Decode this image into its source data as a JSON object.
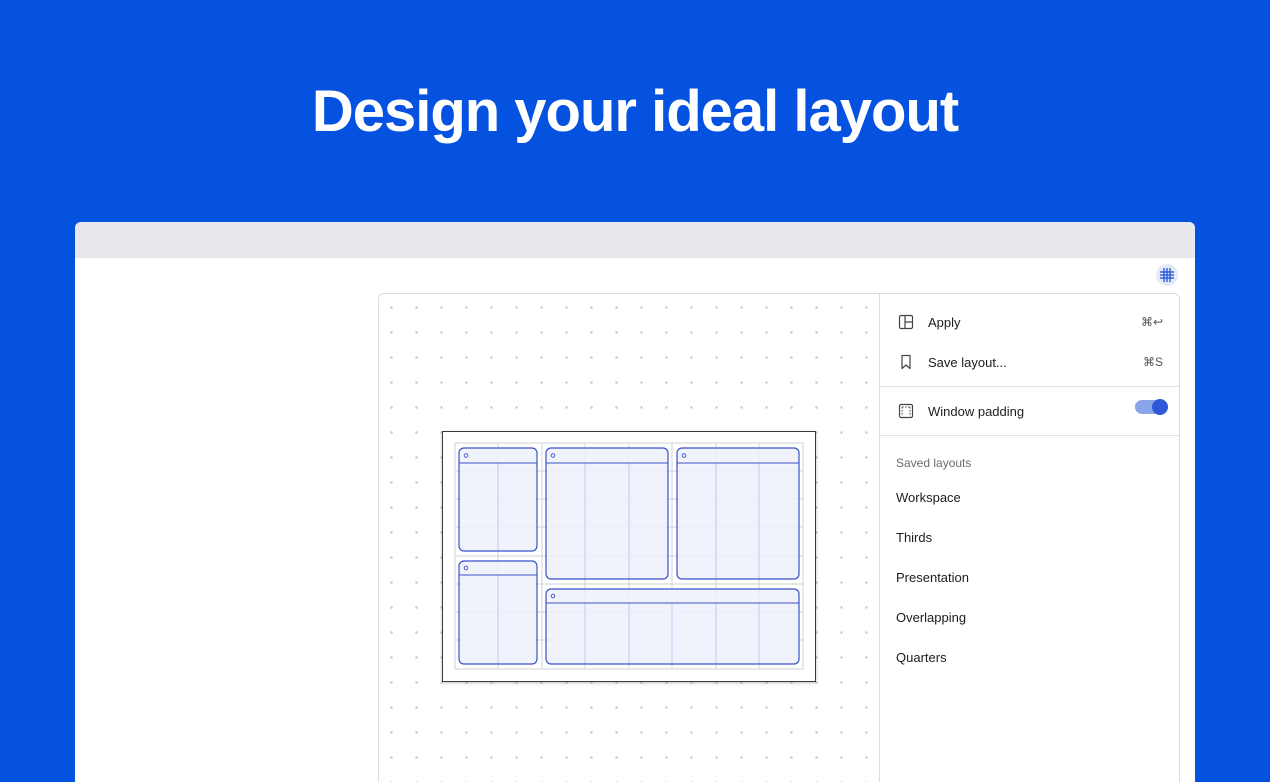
{
  "hero": {
    "title": "Design your ideal layout"
  },
  "toolbar": {
    "grid_icon": "grid-icon"
  },
  "menu": {
    "apply": {
      "label": "Apply",
      "shortcut": "⌘↩",
      "icon": "layout-icon"
    },
    "save": {
      "label": "Save layout...",
      "shortcut": "⌘S",
      "icon": "bookmark-icon"
    },
    "padding": {
      "label": "Window padding",
      "icon": "padding-icon",
      "enabled": true
    },
    "saved_title": "Saved layouts",
    "saved_layouts": [
      "Workspace",
      "Thirds",
      "Presentation",
      "Overlapping",
      "Quarters"
    ]
  },
  "colors": {
    "background": "#0652e0",
    "accent": "#2c59d8",
    "window_stroke": "#3a52c9",
    "window_fill": "#f1f4fc"
  }
}
